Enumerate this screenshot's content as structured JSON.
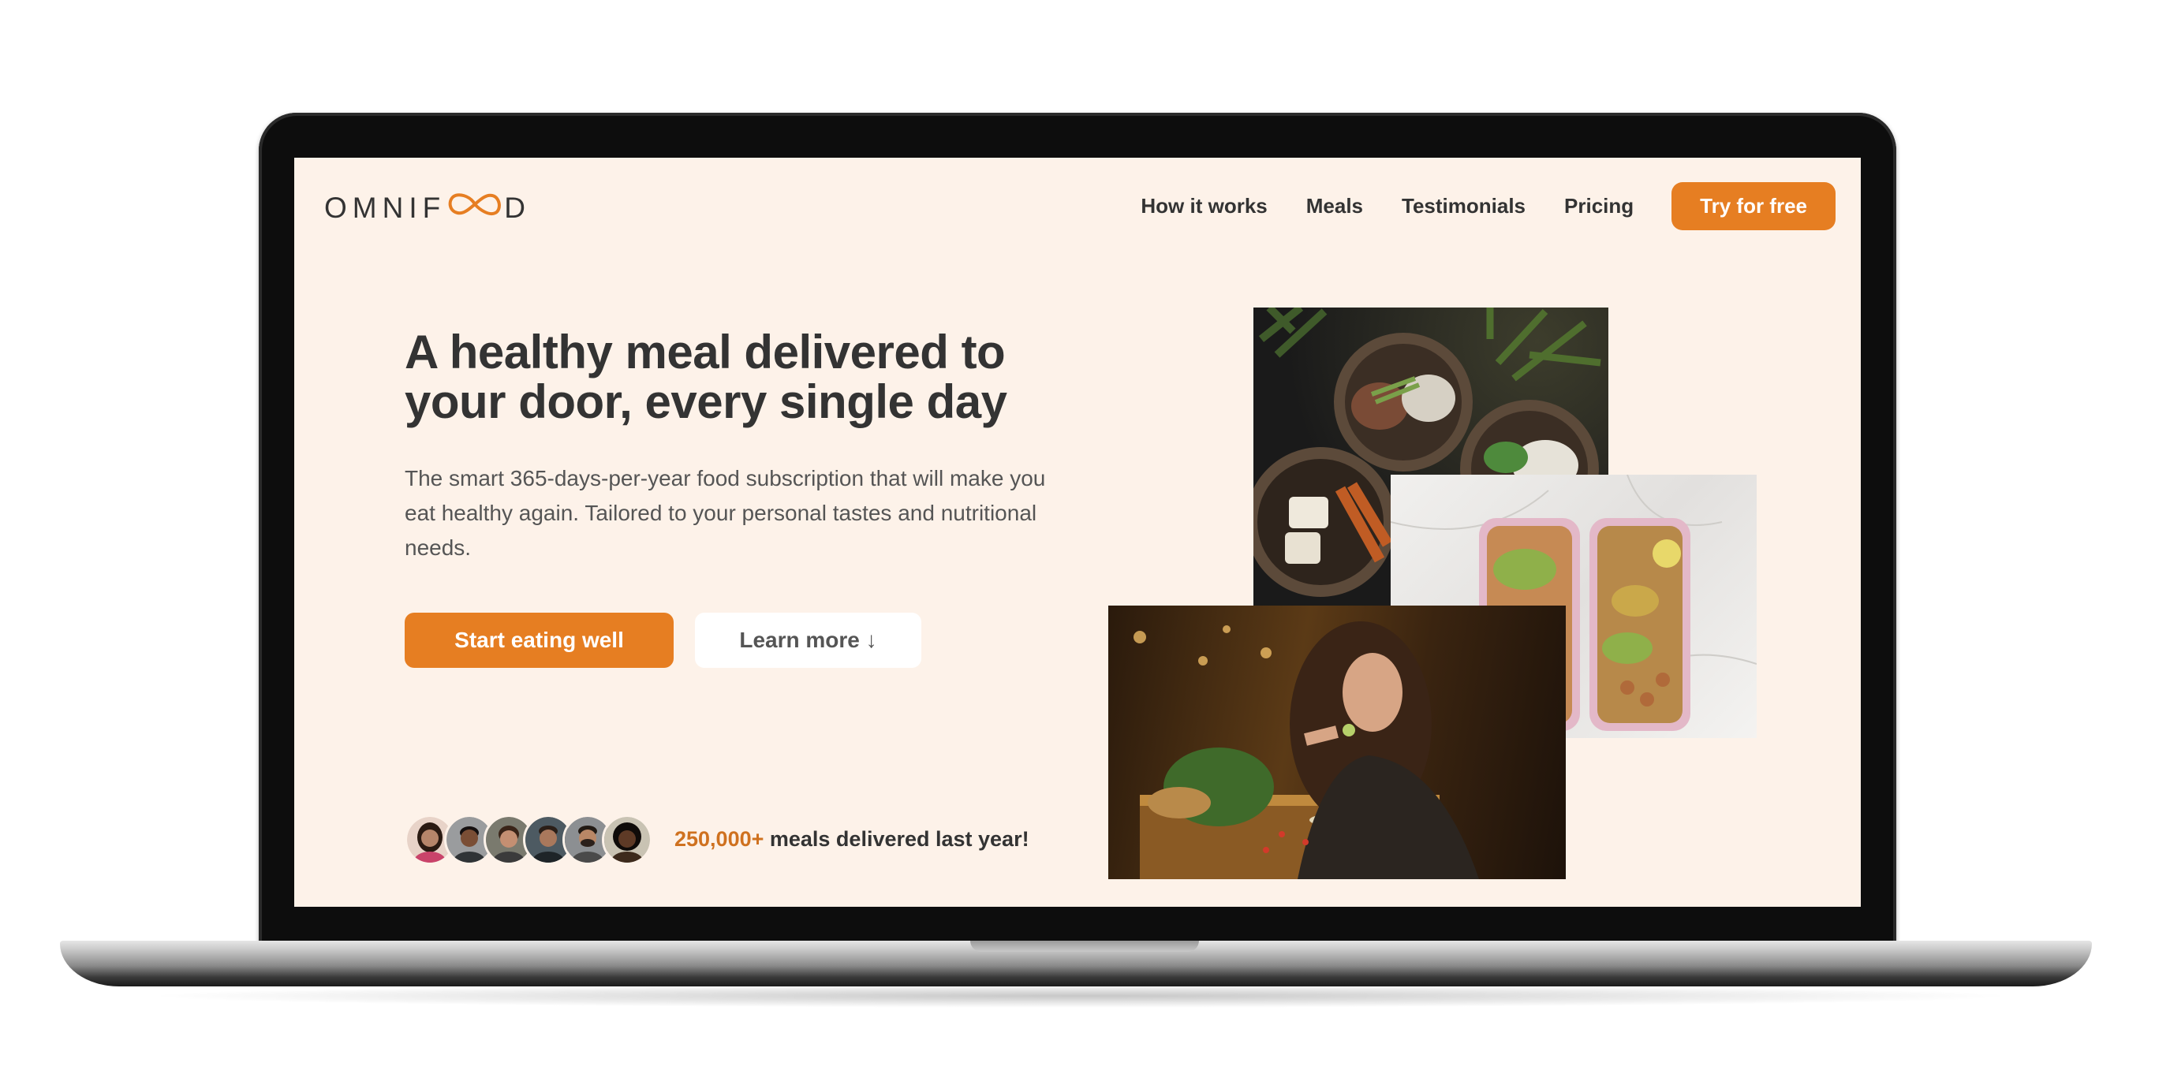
{
  "brand": {
    "logo_text_left": "OMNIF",
    "logo_text_right": "D",
    "accent": "#e67e22"
  },
  "nav": {
    "links": [
      "How it works",
      "Meals",
      "Testimonials",
      "Pricing"
    ],
    "cta_label": "Try for free"
  },
  "hero": {
    "headline": "A healthy meal delivered to your door, every single day",
    "description": "The smart 365-days-per-year food subscription that will make you eat healthy again. Tailored to your personal tastes and nutritional needs.",
    "primary_button": "Start eating well",
    "secondary_button": "Learn more ↓",
    "delivered_count": "250,000+",
    "delivered_text": " meals delivered last year!"
  },
  "avatars": [
    {
      "skin": "#b5856a",
      "hair": "#2a1a12",
      "bg": "#e8d3c8"
    },
    {
      "skin": "#7a4e35",
      "hair": "#151010",
      "bg": "#9a9c9e"
    },
    {
      "skin": "#c48f72",
      "hair": "#3a2418",
      "bg": "#7a7a6e"
    },
    {
      "skin": "#a9785c",
      "hair": "#2b1f18",
      "bg": "#4d5a62"
    },
    {
      "skin": "#b98766",
      "hair": "#221a14",
      "bg": "#8c8f92"
    },
    {
      "skin": "#5e3a26",
      "hair": "#0f0b09",
      "bg": "#c9c3b3"
    }
  ]
}
